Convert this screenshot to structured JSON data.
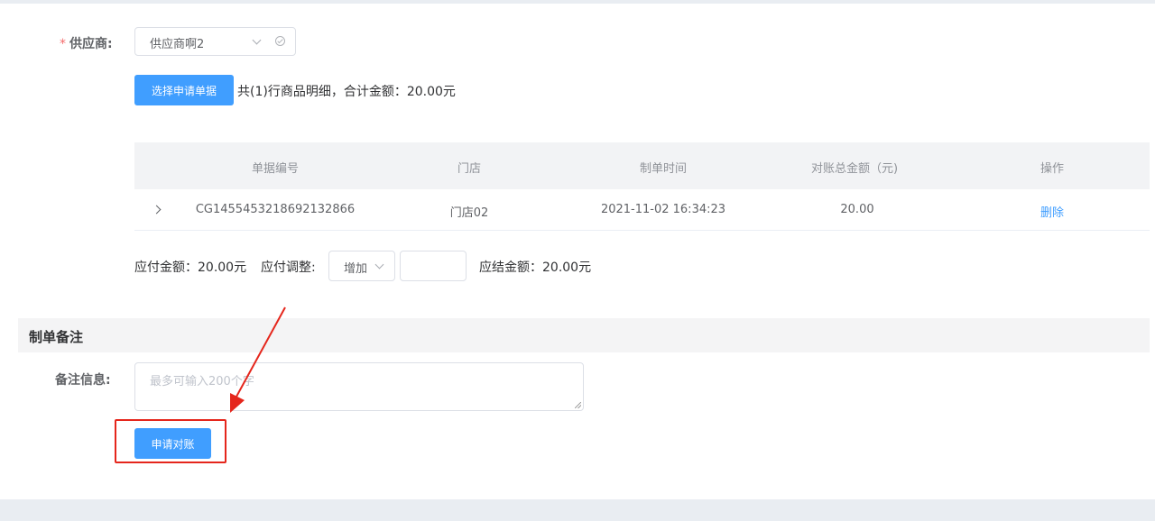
{
  "form": {
    "supplier_label": "供应商:",
    "supplier_required_mark": "*",
    "supplier_value": "供应商啊2"
  },
  "toolbar": {
    "select_docs_label": "选择申请单据",
    "summary": "共(1)行商品明细，合计金额：20.00元"
  },
  "table": {
    "columns": [
      "单据编号",
      "门店",
      "制单时间",
      "对账总金额（元)",
      "操作"
    ],
    "rows": [
      {
        "doc_no": "CG1455453218692132866",
        "store": "门店02",
        "created_at": "2021-11-02 16:34:23",
        "amount": "20.00",
        "action": "删除"
      }
    ]
  },
  "payment": {
    "payable": "应付金额：20.00元",
    "adjust_label": "应付调整:",
    "adjust_type": "增加",
    "adjust_value": "",
    "settle": "应结金额：20.00元"
  },
  "remarks": {
    "section_title": "制单备注",
    "label": "备注信息:",
    "placeholder": "最多可输入200个字"
  },
  "submit": {
    "label": "申请对账"
  },
  "colors": {
    "primary": "#409eff",
    "annotation": "#e5261c",
    "required": "#f56c6c"
  }
}
